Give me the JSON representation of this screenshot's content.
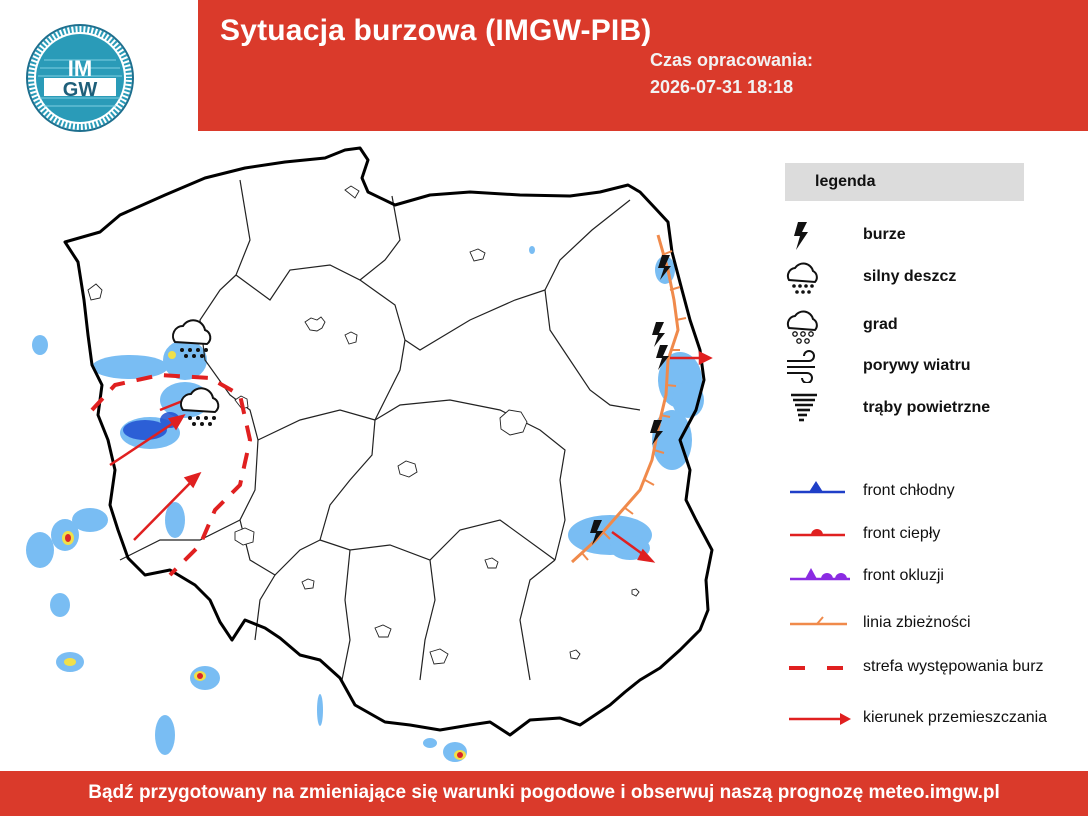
{
  "header": {
    "title": "Sytuacja burzowa (IMGW-PIB)",
    "time_label": "Czas opracowania:",
    "time_value": "2026-07-31 18:18"
  },
  "logo": {
    "main_text": "IM GW",
    "ring_text": "INSTYTUT METEOROLOGII I GOSPODARKI WODNEJ · PAŃSTWOWY INSTYTUT BADAWCZY"
  },
  "legend": {
    "title": "legenda",
    "items": [
      {
        "label": "burze",
        "icon": "lightning-icon"
      },
      {
        "label": "silny deszcz",
        "icon": "heavy-rain-icon"
      },
      {
        "label": "grad",
        "icon": "hail-icon"
      },
      {
        "label": "porywy wiatru",
        "icon": "wind-gust-icon"
      },
      {
        "label": "trąby powietrzne",
        "icon": "tornado-icon"
      },
      {
        "label": "front chłodny",
        "icon": "cold-front-icon"
      },
      {
        "label": "front ciepły",
        "icon": "warm-front-icon"
      },
      {
        "label": "front okluzji",
        "icon": "occluded-front-icon"
      },
      {
        "label": "linia zbieżności",
        "icon": "convergence-line-icon"
      },
      {
        "label": "strefa występowania burz",
        "icon": "storm-zone-icon"
      },
      {
        "label": "kierunek przemieszczania",
        "icon": "movement-direction-icon"
      }
    ]
  },
  "colors": {
    "brand_red": "#da3a2b",
    "border": "#000000",
    "radar_blue": "#5aa8f0",
    "convergence": "#f08a4b",
    "arrow": "#e02020"
  },
  "footer": {
    "text": "Bądź przygotowany na zmieniające się warunki pogodowe i obserwuj naszą prognozę meteo.imgw.pl"
  }
}
